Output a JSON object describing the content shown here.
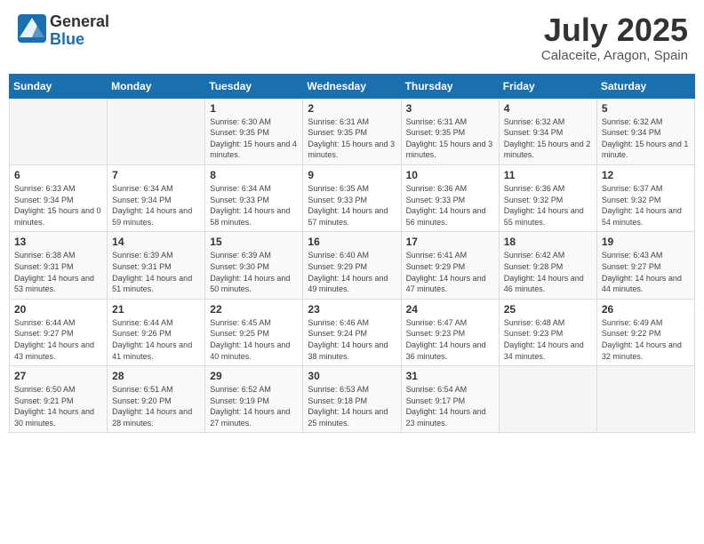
{
  "header": {
    "logo_general": "General",
    "logo_blue": "Blue",
    "month": "July 2025",
    "location": "Calaceite, Aragon, Spain"
  },
  "weekdays": [
    "Sunday",
    "Monday",
    "Tuesday",
    "Wednesday",
    "Thursday",
    "Friday",
    "Saturday"
  ],
  "weeks": [
    [
      {
        "day": "",
        "info": ""
      },
      {
        "day": "",
        "info": ""
      },
      {
        "day": "1",
        "info": "Sunrise: 6:30 AM\nSunset: 9:35 PM\nDaylight: 15 hours and 4 minutes."
      },
      {
        "day": "2",
        "info": "Sunrise: 6:31 AM\nSunset: 9:35 PM\nDaylight: 15 hours and 3 minutes."
      },
      {
        "day": "3",
        "info": "Sunrise: 6:31 AM\nSunset: 9:35 PM\nDaylight: 15 hours and 3 minutes."
      },
      {
        "day": "4",
        "info": "Sunrise: 6:32 AM\nSunset: 9:34 PM\nDaylight: 15 hours and 2 minutes."
      },
      {
        "day": "5",
        "info": "Sunrise: 6:32 AM\nSunset: 9:34 PM\nDaylight: 15 hours and 1 minute."
      }
    ],
    [
      {
        "day": "6",
        "info": "Sunrise: 6:33 AM\nSunset: 9:34 PM\nDaylight: 15 hours and 0 minutes."
      },
      {
        "day": "7",
        "info": "Sunrise: 6:34 AM\nSunset: 9:34 PM\nDaylight: 14 hours and 59 minutes."
      },
      {
        "day": "8",
        "info": "Sunrise: 6:34 AM\nSunset: 9:33 PM\nDaylight: 14 hours and 58 minutes."
      },
      {
        "day": "9",
        "info": "Sunrise: 6:35 AM\nSunset: 9:33 PM\nDaylight: 14 hours and 57 minutes."
      },
      {
        "day": "10",
        "info": "Sunrise: 6:36 AM\nSunset: 9:33 PM\nDaylight: 14 hours and 56 minutes."
      },
      {
        "day": "11",
        "info": "Sunrise: 6:36 AM\nSunset: 9:32 PM\nDaylight: 14 hours and 55 minutes."
      },
      {
        "day": "12",
        "info": "Sunrise: 6:37 AM\nSunset: 9:32 PM\nDaylight: 14 hours and 54 minutes."
      }
    ],
    [
      {
        "day": "13",
        "info": "Sunrise: 6:38 AM\nSunset: 9:31 PM\nDaylight: 14 hours and 53 minutes."
      },
      {
        "day": "14",
        "info": "Sunrise: 6:39 AM\nSunset: 9:31 PM\nDaylight: 14 hours and 51 minutes."
      },
      {
        "day": "15",
        "info": "Sunrise: 6:39 AM\nSunset: 9:30 PM\nDaylight: 14 hours and 50 minutes."
      },
      {
        "day": "16",
        "info": "Sunrise: 6:40 AM\nSunset: 9:29 PM\nDaylight: 14 hours and 49 minutes."
      },
      {
        "day": "17",
        "info": "Sunrise: 6:41 AM\nSunset: 9:29 PM\nDaylight: 14 hours and 47 minutes."
      },
      {
        "day": "18",
        "info": "Sunrise: 6:42 AM\nSunset: 9:28 PM\nDaylight: 14 hours and 46 minutes."
      },
      {
        "day": "19",
        "info": "Sunrise: 6:43 AM\nSunset: 9:27 PM\nDaylight: 14 hours and 44 minutes."
      }
    ],
    [
      {
        "day": "20",
        "info": "Sunrise: 6:44 AM\nSunset: 9:27 PM\nDaylight: 14 hours and 43 minutes."
      },
      {
        "day": "21",
        "info": "Sunrise: 6:44 AM\nSunset: 9:26 PM\nDaylight: 14 hours and 41 minutes."
      },
      {
        "day": "22",
        "info": "Sunrise: 6:45 AM\nSunset: 9:25 PM\nDaylight: 14 hours and 40 minutes."
      },
      {
        "day": "23",
        "info": "Sunrise: 6:46 AM\nSunset: 9:24 PM\nDaylight: 14 hours and 38 minutes."
      },
      {
        "day": "24",
        "info": "Sunrise: 6:47 AM\nSunset: 9:23 PM\nDaylight: 14 hours and 36 minutes."
      },
      {
        "day": "25",
        "info": "Sunrise: 6:48 AM\nSunset: 9:23 PM\nDaylight: 14 hours and 34 minutes."
      },
      {
        "day": "26",
        "info": "Sunrise: 6:49 AM\nSunset: 9:22 PM\nDaylight: 14 hours and 32 minutes."
      }
    ],
    [
      {
        "day": "27",
        "info": "Sunrise: 6:50 AM\nSunset: 9:21 PM\nDaylight: 14 hours and 30 minutes."
      },
      {
        "day": "28",
        "info": "Sunrise: 6:51 AM\nSunset: 9:20 PM\nDaylight: 14 hours and 28 minutes."
      },
      {
        "day": "29",
        "info": "Sunrise: 6:52 AM\nSunset: 9:19 PM\nDaylight: 14 hours and 27 minutes."
      },
      {
        "day": "30",
        "info": "Sunrise: 6:53 AM\nSunset: 9:18 PM\nDaylight: 14 hours and 25 minutes."
      },
      {
        "day": "31",
        "info": "Sunrise: 6:54 AM\nSunset: 9:17 PM\nDaylight: 14 hours and 23 minutes."
      },
      {
        "day": "",
        "info": ""
      },
      {
        "day": "",
        "info": ""
      }
    ]
  ]
}
